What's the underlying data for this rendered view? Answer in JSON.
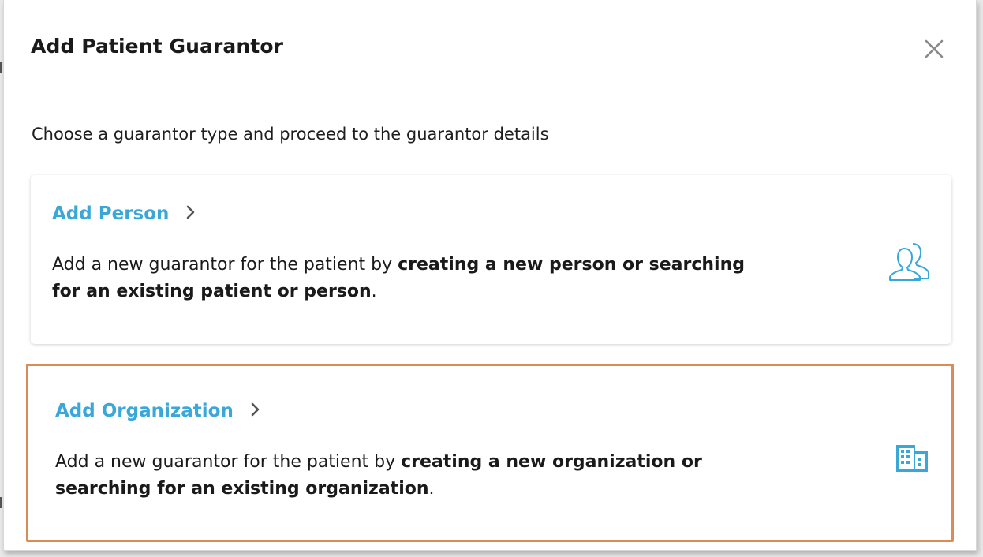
{
  "dialog": {
    "title": "Add Patient Guarantor",
    "close_icon": "close-icon",
    "subtitle": "Choose a guarantor type and proceed to the guarantor details"
  },
  "options": {
    "person": {
      "title": "Add Person",
      "desc_prefix": "Add a new guarantor for the patient by ",
      "desc_bold": "creating a new person or searching for an existing patient or person",
      "desc_suffix": ".",
      "icon": "people-icon"
    },
    "organization": {
      "title": "Add Organization",
      "desc_prefix": "Add a new guarantor for the patient by ",
      "desc_bold": "creating a new organization or searching for an existing organization",
      "desc_suffix": ".",
      "icon": "building-icon",
      "highlighted": true
    }
  },
  "colors": {
    "accent": "#3aa7d9",
    "highlight_border": "#d98c57",
    "text": "#1a1a1a"
  }
}
